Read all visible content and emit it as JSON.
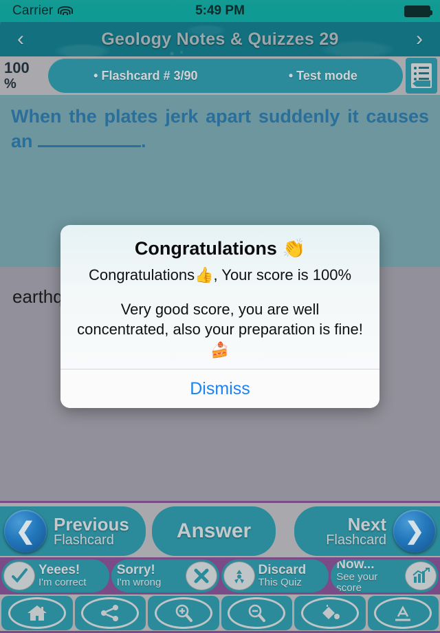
{
  "status_bar": {
    "carrier": "Carrier",
    "wifi_icon": "wifi-icon",
    "time": "5:49 PM",
    "battery_icon": "battery-full-icon"
  },
  "nav_bar": {
    "back_label": "‹",
    "title": "Geology Notes & Quizzes 29",
    "forward_label": "›"
  },
  "info_bar": {
    "score_number": "100",
    "score_percent": "%",
    "flashcard_counter": "• Flashcard #  3/90",
    "mode": "• Test mode",
    "notes_icon": "notes-list-icon"
  },
  "question": {
    "part1": "When  the  plates  jerk  apart  suddenly  it  causes  an ",
    "blank": "",
    "part2": "."
  },
  "answer": {
    "text": "earthquake"
  },
  "modal": {
    "title": "Congratulations",
    "title_emoji": "👏",
    "message1": "Congratulations👍, Your score is 100%",
    "message2": "Very good score, you are well concentrated, also your preparation is fine!🍰",
    "dismiss_label": "Dismiss",
    "dismiss_color": "#1c82f2"
  },
  "nav_row": {
    "previous": {
      "line1": "Previous",
      "line2": "Flashcard",
      "icon": "chevron-left-icon",
      "glyph": "❮"
    },
    "answer": {
      "label": "Answer"
    },
    "next": {
      "line1": "Next",
      "line2": "Flashcard",
      "icon": "chevron-right-icon",
      "glyph": "❯"
    }
  },
  "action_row": [
    {
      "name": "correct",
      "line1": "Yeees!",
      "line2": "I'm correct",
      "icon": "check-icon",
      "icon_side": "left"
    },
    {
      "name": "wrong",
      "line1": "Sorry!",
      "line2": "I'm wrong",
      "icon": "cross-icon",
      "icon_side": "right"
    },
    {
      "name": "discard",
      "line1": "Discard",
      "line2": "This Quiz",
      "icon": "recycle-icon",
      "icon_side": "left"
    },
    {
      "name": "score",
      "line1": "Now...",
      "line2": "See your score",
      "icon": "chart-icon",
      "icon_side": "right"
    }
  ],
  "tab_bar": [
    {
      "name": "home",
      "icon": "home-icon"
    },
    {
      "name": "share",
      "icon": "share-icon"
    },
    {
      "name": "zoom-in",
      "icon": "magnifier-plus-icon"
    },
    {
      "name": "zoom-out",
      "icon": "magnifier-minus-icon"
    },
    {
      "name": "theme",
      "icon": "paint-bucket-icon"
    },
    {
      "name": "font",
      "icon": "text-format-icon"
    }
  ],
  "colors": {
    "teal_accent": "#2b8b9b",
    "nav_teal": "#13717f",
    "status_teal": "#129a93",
    "gray_panel": "#92909a",
    "question_panel": "#6e969f",
    "question_text": "#2a6f9a",
    "purple_divider": "#7a4b86",
    "blue_circle": "#2277bb"
  }
}
